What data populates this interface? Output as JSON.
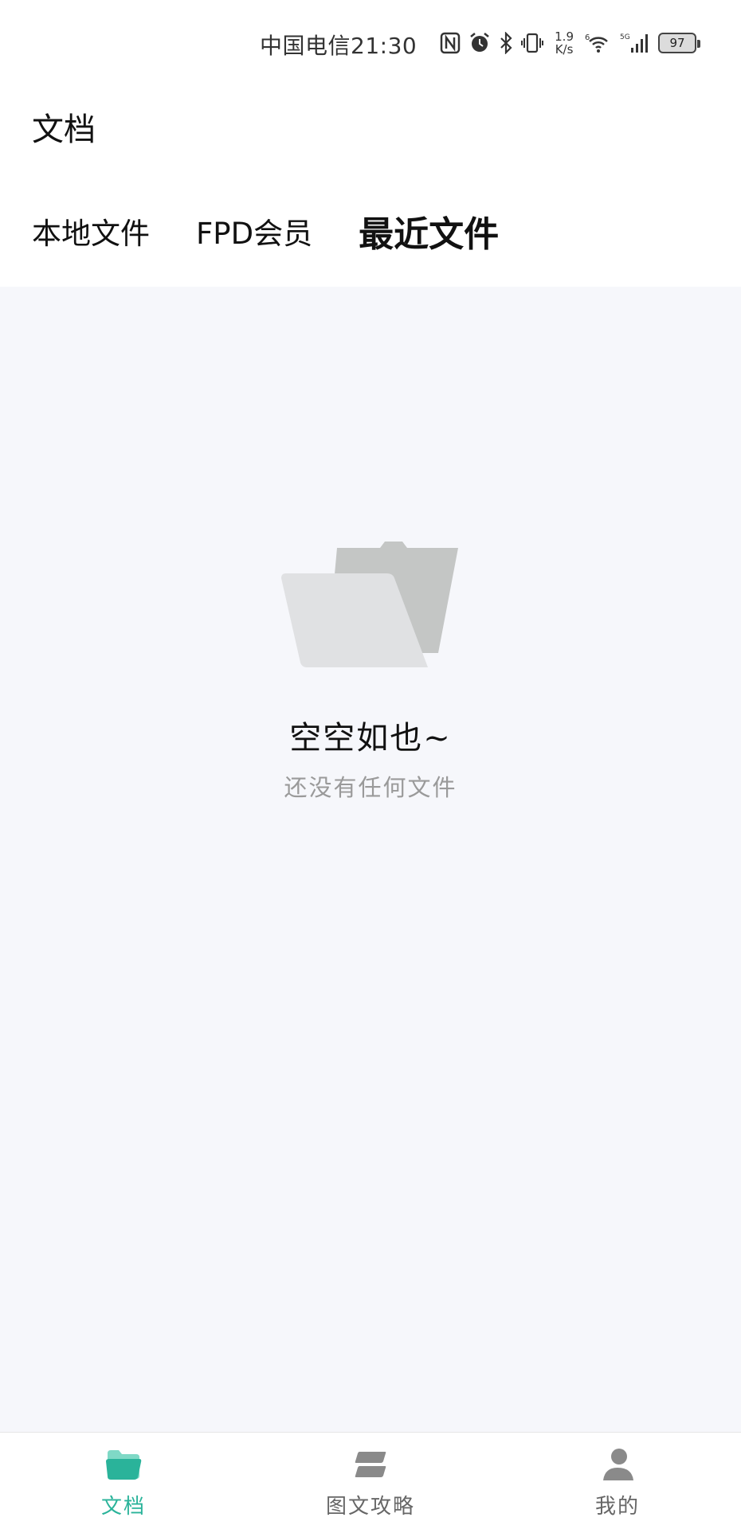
{
  "status_bar": {
    "carrier_time": "中国电信21:30",
    "net_speed_value": "1.9",
    "net_speed_unit": "K/s",
    "battery": "97",
    "icons": [
      "nfc-icon",
      "alarm-icon",
      "bluetooth-icon",
      "vibrate-icon",
      "wifi-icon",
      "signal-5g-icon"
    ]
  },
  "header": {
    "title": "文档"
  },
  "tabs": [
    {
      "label": "本地文件",
      "active": false
    },
    {
      "label": "FPD会员",
      "active": false
    },
    {
      "label": "最近文件",
      "active": true
    }
  ],
  "empty_state": {
    "icon": "folder-icon",
    "title": "空空如也~",
    "subtitle": "还没有任何文件"
  },
  "bottom_nav": [
    {
      "label": "文档",
      "icon": "folder-icon",
      "active": true
    },
    {
      "label": "图文攻略",
      "icon": "stack-icon",
      "active": false
    },
    {
      "label": "我的",
      "icon": "user-icon",
      "active": false
    }
  ],
  "colors": {
    "accent": "#2ab39a",
    "background": "#f6f7fb",
    "muted_text": "#9a9a9a"
  }
}
